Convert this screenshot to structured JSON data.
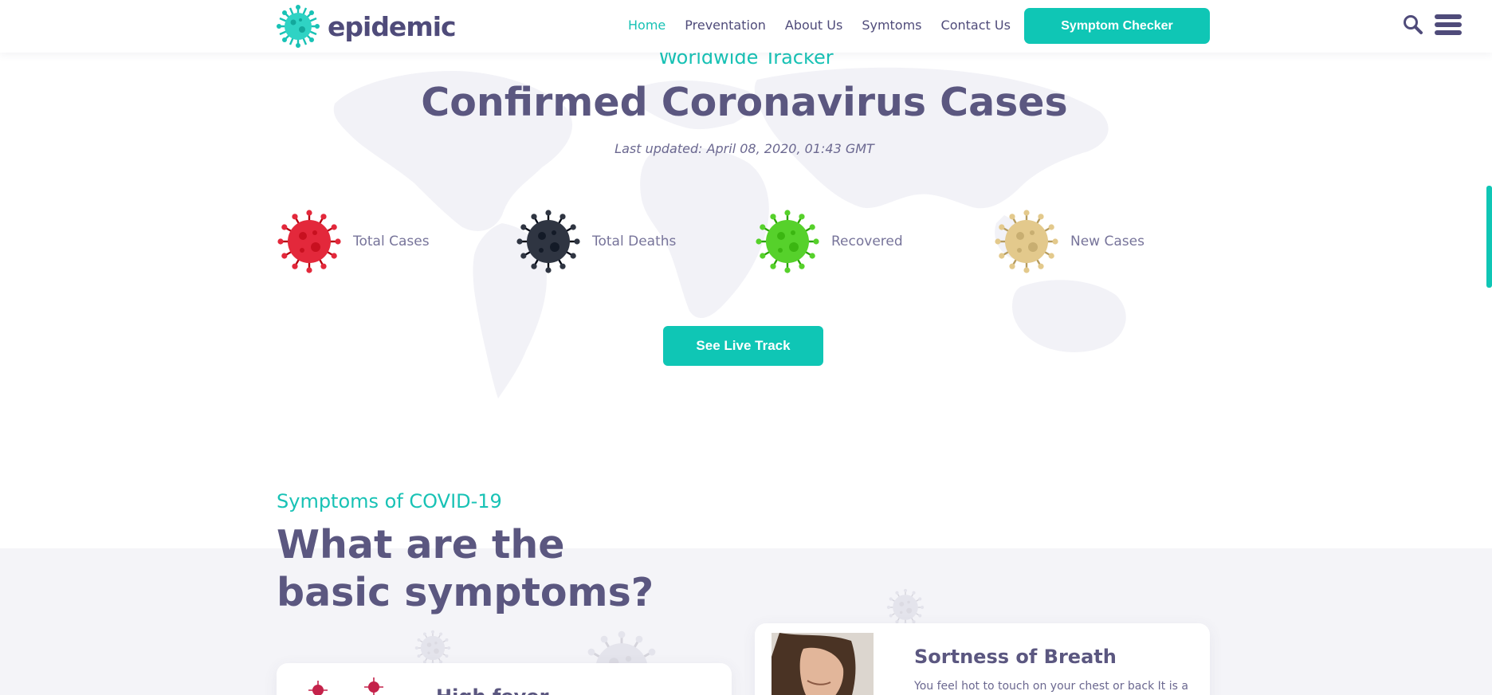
{
  "header": {
    "logo_text": "epidemic",
    "nav": [
      "Home",
      "Preventation",
      "About Us",
      "Symtoms",
      "Contact Us"
    ],
    "active_nav": "Home",
    "cta_label": "Symptom Checker"
  },
  "tracker": {
    "eyebrow": "Worldwide Tracker",
    "title": "Confirmed Coronavirus Cases",
    "updated": "Last updated: April 08, 2020, 01:43 GMT",
    "stats": [
      {
        "label": "Total Cases",
        "color": "#e3283b"
      },
      {
        "label": "Total Deaths",
        "color": "#2f3542"
      },
      {
        "label": "Recovered",
        "color": "#56d12b"
      },
      {
        "label": "New Cases",
        "color": "#e3c98c"
      }
    ],
    "button_label": "See Live Track"
  },
  "symptoms": {
    "eyebrow": "Symptoms of COVID-19",
    "title": "What are the basic symptoms?",
    "cards": [
      {
        "title": "High fever"
      },
      {
        "title": "Sortness of Breath",
        "desc": "You feel hot to touch on your chest or back It is a"
      }
    ]
  },
  "colors": {
    "accent": "#0fc6b5",
    "heading": "#5b5780",
    "band": "#f4f4f8"
  }
}
